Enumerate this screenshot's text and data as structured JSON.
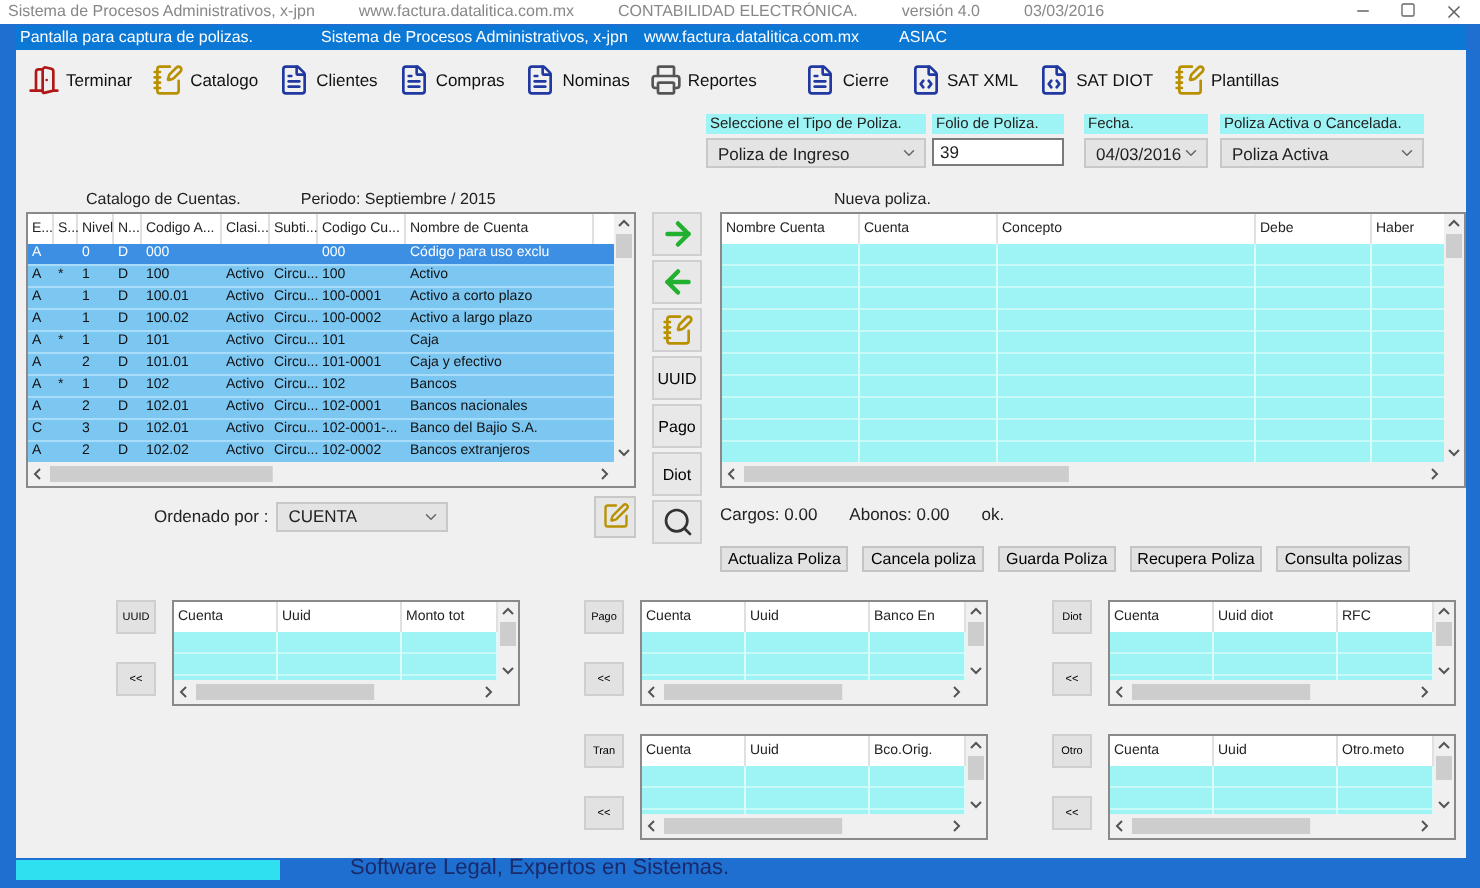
{
  "outer_window": {
    "title_parts": [
      "Sistema de Procesos Administrativos,  x-jpn",
      "www.factura.datalitica.com.mx",
      "CONTABILIDAD ELECTRÓNICA.",
      "versión 4.0",
      "03/03/2016"
    ],
    "footer": "Software Legal, Expertos en Sistemas."
  },
  "dialog": {
    "title_parts": [
      "Pantalla para captura de polizas.",
      "Sistema de Procesos Administrativos,  x-jpn",
      "www.factura.datalitica.com.mx",
      "ASIAC"
    ]
  },
  "toolbar": [
    {
      "label": "Terminar"
    },
    {
      "label": "Catalogo"
    },
    {
      "label": "Clientes"
    },
    {
      "label": "Compras"
    },
    {
      "label": "Nominas"
    },
    {
      "label": "Reportes"
    },
    {
      "label": "Cierre"
    },
    {
      "label": "SAT XML"
    },
    {
      "label": "SAT DIOT"
    },
    {
      "label": "Plantillas"
    }
  ],
  "poliza_fields": [
    {
      "label": "Seleccione el Tipo de Poliza.",
      "kind": "select",
      "value": "Poliza de Ingreso"
    },
    {
      "label": "Folio de Poliza.",
      "kind": "input",
      "value": "39"
    },
    {
      "label": "Fecha.",
      "kind": "select",
      "value": "04/03/2016"
    },
    {
      "label": "Poliza Activa o Cancelada.",
      "kind": "select",
      "value": "Poliza Activa"
    }
  ],
  "catalog": {
    "caption": "Catalogo de Cuentas.",
    "period": "Periodo: Septiembre  /  2015",
    "columns": [
      "E...",
      "S...",
      "Nivel",
      "N...",
      "Codigo A...",
      "Clasi...",
      "Subti...",
      "Codigo Cu...",
      "Nombre de Cuenta"
    ],
    "rows": [
      {
        "selected": true,
        "cells": [
          "A",
          "",
          "0",
          "D",
          "000",
          "",
          "",
          "000",
          "Código para uso exclu"
        ]
      },
      {
        "selected": false,
        "cells": [
          "A",
          "*",
          "1",
          "D",
          "100",
          "Activo",
          "Circu...",
          "100",
          "Activo"
        ]
      },
      {
        "selected": false,
        "cells": [
          "A",
          "",
          "1",
          "D",
          "100.01",
          "Activo",
          "Circu...",
          "100-0001",
          "Activo a corto plazo"
        ]
      },
      {
        "selected": false,
        "cells": [
          "A",
          "",
          "1",
          "D",
          "100.02",
          "Activo",
          "Circu...",
          "100-0002",
          "Activo a largo plazo"
        ]
      },
      {
        "selected": false,
        "cells": [
          "A",
          "*",
          "1",
          "D",
          "101",
          "Activo",
          "Circu...",
          "101",
          "Caja"
        ]
      },
      {
        "selected": false,
        "cells": [
          "A",
          "",
          "2",
          "D",
          "101.01",
          "Activo",
          "Circu...",
          "101-0001",
          "Caja y efectivo"
        ]
      },
      {
        "selected": false,
        "cells": [
          "A",
          "*",
          "1",
          "D",
          "102",
          "Activo",
          "Circu...",
          "102",
          "Bancos"
        ]
      },
      {
        "selected": false,
        "cells": [
          "A",
          "",
          "2",
          "D",
          "102.01",
          "Activo",
          "Circu...",
          "102-0001",
          "Bancos nacionales"
        ]
      },
      {
        "selected": false,
        "cells": [
          "C",
          "",
          "3",
          "D",
          "102.01",
          "Activo",
          "Circu...",
          "102-0001-...",
          "Banco del Bajio S.A."
        ]
      },
      {
        "selected": false,
        "cells": [
          "A",
          "",
          "2",
          "D",
          "102.02",
          "Activo",
          "Circu...",
          "102-0002",
          "Bancos extranjeros"
        ]
      }
    ],
    "sort_label": "Ordenado por :",
    "sort_value": "CUENTA"
  },
  "middle_buttons": [
    {
      "kind": "right-arrow"
    },
    {
      "kind": "left-arrow"
    },
    {
      "kind": "note"
    },
    {
      "kind": "text",
      "label": "UUID"
    },
    {
      "kind": "text",
      "label": "Pago"
    },
    {
      "kind": "text",
      "label": "Diot"
    }
  ],
  "poliza": {
    "caption": "Nueva poliza.",
    "columns": [
      "Nombre Cuenta",
      "Cuenta",
      "Concepto",
      "Debe",
      "Haber"
    ],
    "totals": [
      "Cargos:  0.00",
      "Abonos:  0.00",
      "ok."
    ],
    "buttons": [
      "Actualiza Poliza",
      "Cancela poliza",
      "Guarda Poliza",
      "Recupera Poliza",
      "Consulta polizas"
    ]
  },
  "mini_tables": [
    [
      {
        "button": "UUID",
        "back": "<<",
        "columns": [
          "Cuenta",
          "Uuid",
          "Monto tot"
        ]
      },
      {
        "button": "Pago",
        "back": "<<",
        "columns": [
          "Cuenta",
          "Uuid",
          "Banco En"
        ]
      },
      {
        "button": "Diot",
        "back": "<<",
        "columns": [
          "Cuenta",
          "Uuid diot",
          "RFC"
        ]
      }
    ],
    [
      {
        "button": "Tran",
        "back": "<<",
        "columns": [
          "Cuenta",
          "Uuid",
          "Bco.Orig."
        ]
      },
      {
        "button": "Otro",
        "back": "<<",
        "columns": [
          "Cuenta",
          "Uuid",
          "Otro.meto"
        ]
      }
    ]
  ]
}
